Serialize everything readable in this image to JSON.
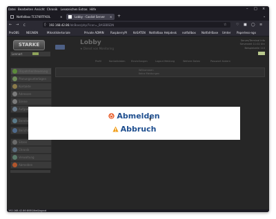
{
  "menubar": {
    "items": [
      "Datei",
      "Bearbeiten",
      "Ansicht",
      "Chronik",
      "Lesezeichen",
      "Extras",
      "Hilfe"
    ],
    "controls": [
      "–",
      "□",
      "×"
    ]
  },
  "tabs": [
    {
      "label": "Notfallbox TCSTKRTFKOL",
      "active": false
    },
    {
      "label": "Lobby - Coolist Server",
      "active": true
    }
  ],
  "new_tab": "+",
  "nav": {
    "back": "←",
    "forward": "→",
    "reload": "C"
  },
  "url": {
    "host": "192.168.42.86",
    "path": "/idcBoxs/php/?icon=_BASBBSDN"
  },
  "bookmarks": [
    "ProOBS",
    "NEGNEN",
    "Mikrotiklertoriale",
    "Private ADMIN",
    "RaspberryPI",
    "KeSATEN",
    "Notfallbox Helpdesk",
    "notfallbox",
    "Notfall-Base",
    "Umter",
    "Paperless-ngx"
  ],
  "app": {
    "logo": "STARKE",
    "user": "Lennart",
    "title": "Lobby",
    "subtitle": "★  Dienst von Monitoring",
    "right_lines": [
      "Server/Terminal Info",
      "Serverzeit 11:02 Uhr",
      "Beispielzeile 110"
    ],
    "nav_tabs": [
      "Profil",
      "Kontaktdaten",
      "Einstellungen",
      "Logout Meldung",
      "Weitere Daten",
      "Passwort ändern"
    ],
    "content_lines": [
      "Willkommen",
      "Keine Meldungen"
    ],
    "sidebar": [
      {
        "label": "Dispatchersteuerung",
        "color": "#5b8a3a"
      },
      {
        "label": "Planungsunterlagen",
        "color": "#6e8b5a"
      },
      {
        "label": "Kontakte",
        "color": "#8a7a4a"
      },
      {
        "label": "Adressen",
        "color": "#7a7a7a"
      },
      {
        "label": "Sirene",
        "color": "#7a7a7a"
      },
      {
        "label": "Aufgaben",
        "color": "#6a7a8a"
      },
      {
        "label": "Bereite Einheit",
        "color": "#5a7a8a"
      },
      {
        "label": "Berichte Beteiligte",
        "color": "#4e6a8c"
      },
      {
        "label": "Sitzen",
        "color": "#6a6a6a"
      },
      {
        "label": "Chronik",
        "color": "#5a6a7a"
      },
      {
        "label": "Verwaltung",
        "color": "#5a7a6a"
      },
      {
        "label": "Abmelden",
        "color": "#b0552c"
      }
    ]
  },
  "modal": {
    "logout_label": "Abmelden",
    "cancel_label": "Abbruch",
    "logout_icon": "power-icon",
    "cancel_icon": "warning-icon"
  },
  "status_text": "192.168.42.86:8080/Ikel/logout"
}
